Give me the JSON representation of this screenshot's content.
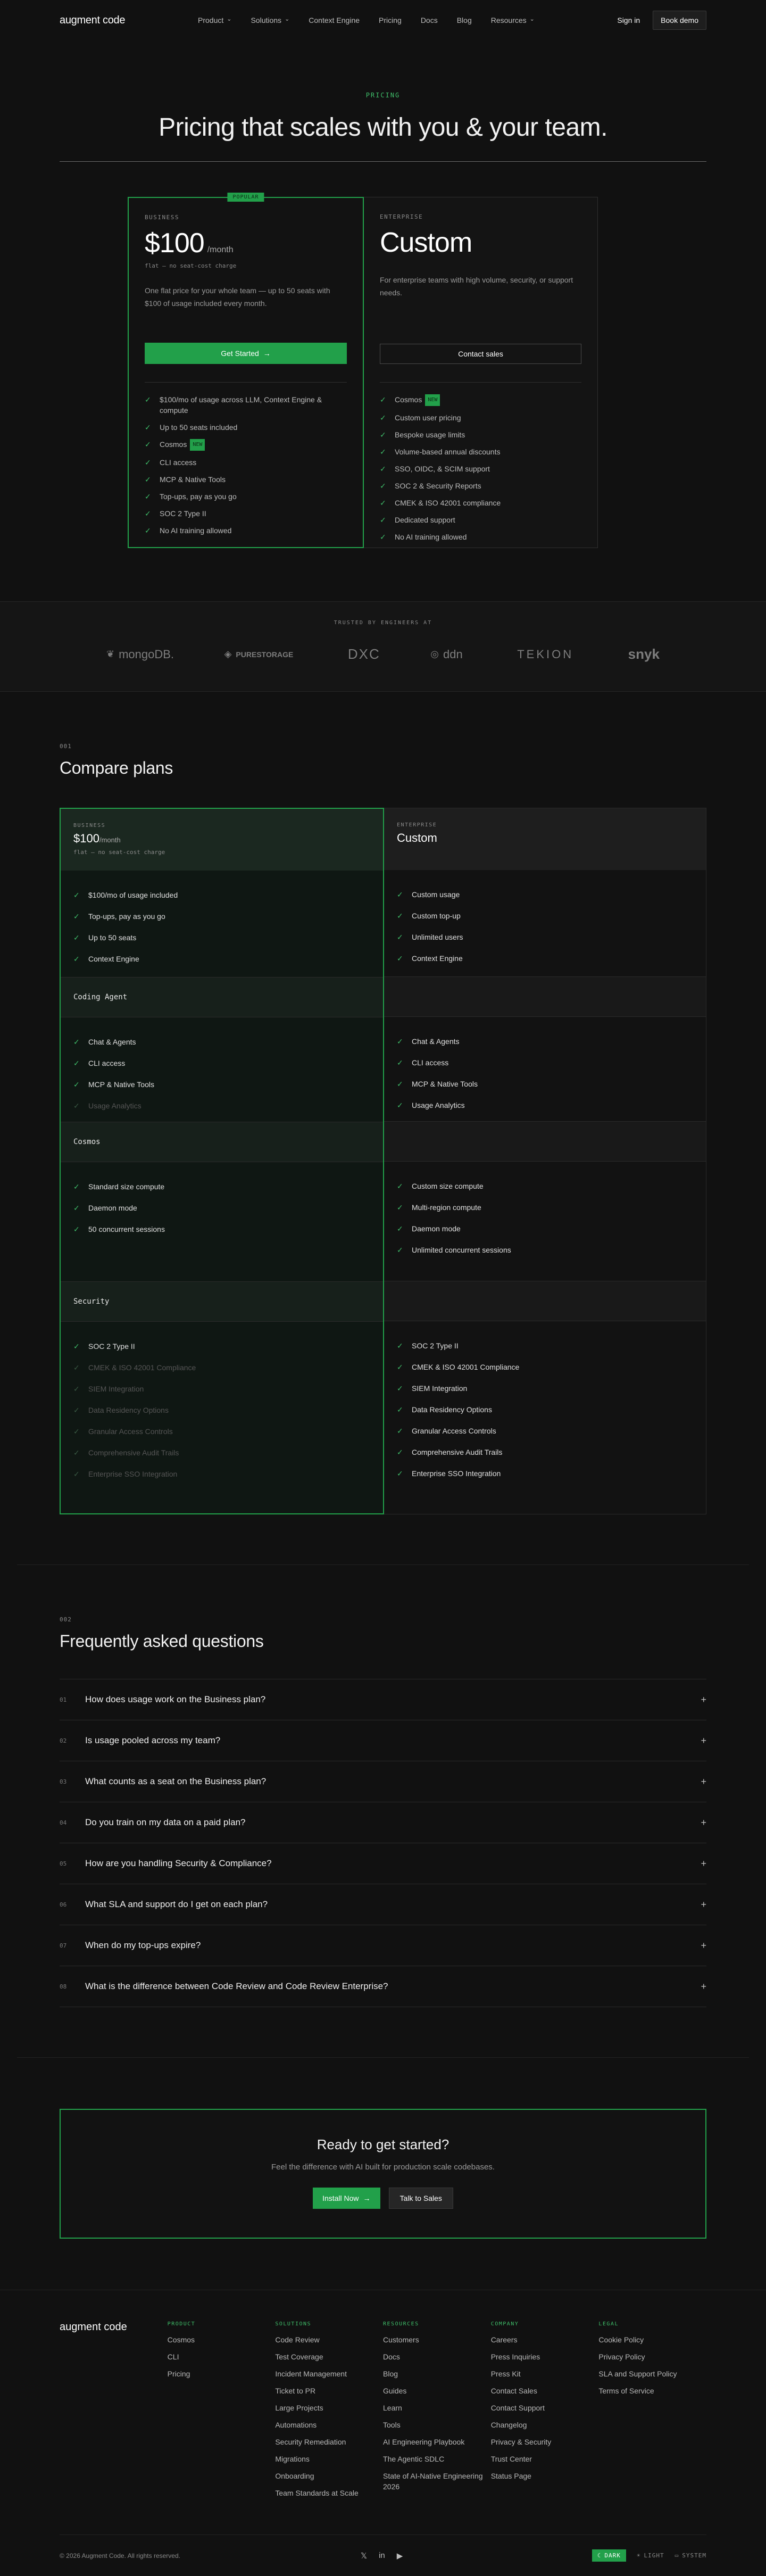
{
  "nav": {
    "logo": "augment code",
    "links": [
      "Product",
      "Solutions",
      "Context Engine",
      "Pricing",
      "Docs",
      "Blog",
      "Resources"
    ],
    "chevrons": [
      true,
      true,
      false,
      false,
      false,
      false,
      true
    ],
    "signin": "Sign in",
    "book_demo": "Book demo"
  },
  "hero": {
    "eyebrow": "PRICING",
    "title": "Pricing that scales with you & your team."
  },
  "plans": {
    "business": {
      "badge": "POPULAR",
      "tier": "BUSINESS",
      "price": "$100",
      "unit": "/month",
      "sub": "flat — no seat-cost charge",
      "desc": "One flat price for your whole team — up to 50 seats with $100 of usage included every month.",
      "cta": "Get Started",
      "features": [
        "$100/mo of usage across LLM, Context Engine & compute",
        "Up to 50 seats included",
        "Cosmos",
        "CLI access",
        "MCP & Native Tools",
        "Top-ups, pay as you go",
        "SOC 2 Type II",
        "No AI training allowed"
      ],
      "new_label": "NEW"
    },
    "enterprise": {
      "tier": "ENTERPRISE",
      "price": "Custom",
      "desc": "For enterprise teams with high volume, security, or support needs.",
      "cta": "Contact sales",
      "features": [
        "Cosmos",
        "Custom user pricing",
        "Bespoke usage limits",
        "Volume-based annual discounts",
        "SSO, OIDC, & SCIM support",
        "SOC 2 & Security Reports",
        "CMEK & ISO 42001 compliance",
        "Dedicated support",
        "No AI training allowed"
      ],
      "new_label": "NEW"
    }
  },
  "trusted": {
    "label": "TRUSTED BY ENGINEERS AT",
    "logos": [
      "mongoDB.",
      "PURESTORAGE",
      "DXC",
      "ddn",
      "TEKION",
      "snyk"
    ]
  },
  "compare": {
    "num": "001",
    "title": "Compare plans",
    "business": {
      "tier": "BUSINESS",
      "price": "$100",
      "unit": "/month",
      "sub": "flat — no seat-cost charge",
      "top": [
        "$100/mo of usage included",
        "Top-ups, pay as you go",
        "Up to 50 seats",
        "Context Engine"
      ],
      "coding": [
        "Chat & Agents",
        "CLI access",
        "MCP & Native Tools",
        "Usage Analytics"
      ],
      "coding_dim": [
        false,
        false,
        false,
        true
      ],
      "cosmos": [
        "Standard size compute",
        "Daemon mode",
        "50 concurrent sessions"
      ],
      "security": [
        "SOC 2 Type II",
        "CMEK & ISO 42001 Compliance",
        "SIEM Integration",
        "Data Residency Options",
        "Granular Access Controls",
        "Comprehensive Audit Trails",
        "Enterprise SSO Integration"
      ],
      "security_dim": [
        false,
        true,
        true,
        true,
        true,
        true,
        true
      ]
    },
    "enterprise": {
      "tier": "ENTERPRISE",
      "price": "Custom",
      "top": [
        "Custom usage",
        "Custom top-up",
        "Unlimited users",
        "Context Engine"
      ],
      "coding": [
        "Chat & Agents",
        "CLI access",
        "MCP & Native Tools",
        "Usage Analytics"
      ],
      "cosmos": [
        "Custom size compute",
        "Multi-region compute",
        "Daemon mode",
        "Unlimited concurrent sessions"
      ],
      "security": [
        "SOC 2 Type II",
        "CMEK & ISO 42001 Compliance",
        "SIEM Integration",
        "Data Residency Options",
        "Granular Access Controls",
        "Comprehensive Audit Trails",
        "Enterprise SSO Integration"
      ]
    },
    "groups": [
      "Coding Agent",
      "Cosmos",
      "Security"
    ]
  },
  "faq": {
    "num": "002",
    "title": "Frequently asked questions",
    "items": [
      {
        "n": "01",
        "q": "How does usage work on the Business plan?"
      },
      {
        "n": "02",
        "q": "Is usage pooled across my team?"
      },
      {
        "n": "03",
        "q": "What counts as a seat on the Business plan?"
      },
      {
        "n": "04",
        "q": "Do you train on my data on a paid plan?"
      },
      {
        "n": "05",
        "q": "How are you handling Security & Compliance?"
      },
      {
        "n": "06",
        "q": "What SLA and support do I get on each plan?"
      },
      {
        "n": "07",
        "q": "When do my top-ups expire?"
      },
      {
        "n": "08",
        "q": "What is the difference between Code Review and Code Review Enterprise?"
      }
    ]
  },
  "cta": {
    "title": "Ready to get started?",
    "desc": "Feel the difference with AI built for production scale codebases.",
    "primary": "Install Now",
    "secondary": "Talk to Sales"
  },
  "footer": {
    "logo": "augment code",
    "columns": [
      {
        "head": "PRODUCT",
        "links": [
          "Cosmos",
          "CLI",
          "Pricing"
        ]
      },
      {
        "head": "SOLUTIONS",
        "links": [
          "Code Review",
          "Test Coverage",
          "Incident Management",
          "Ticket to PR",
          "Large Projects",
          "Automations",
          "Security Remediation",
          "Migrations",
          "Onboarding",
          "Team Standards at Scale"
        ]
      },
      {
        "head": "RESOURCES",
        "links": [
          "Customers",
          "Docs",
          "Blog",
          "Guides",
          "Learn",
          "Tools",
          "AI Engineering Playbook",
          "The Agentic SDLC",
          "State of AI-Native Engineering 2026"
        ]
      },
      {
        "head": "COMPANY",
        "links": [
          "Careers",
          "Press Inquiries",
          "Press Kit",
          "Contact Sales",
          "Contact Support",
          "Changelog",
          "Privacy & Security",
          "Trust Center",
          "Status Page"
        ]
      },
      {
        "head": "LEGAL",
        "links": [
          "Cookie Policy",
          "Privacy Policy",
          "SLA and Support Policy",
          "Terms of Service"
        ]
      }
    ],
    "copyright": "© 2026 Augment Code. All rights reserved.",
    "social": [
      "𝕏",
      "in",
      "▶"
    ],
    "theme": [
      "DARK",
      "LIGHT",
      "SYSTEM"
    ]
  },
  "colors": {
    "accent": "#22a04a",
    "bg": "#111111"
  }
}
